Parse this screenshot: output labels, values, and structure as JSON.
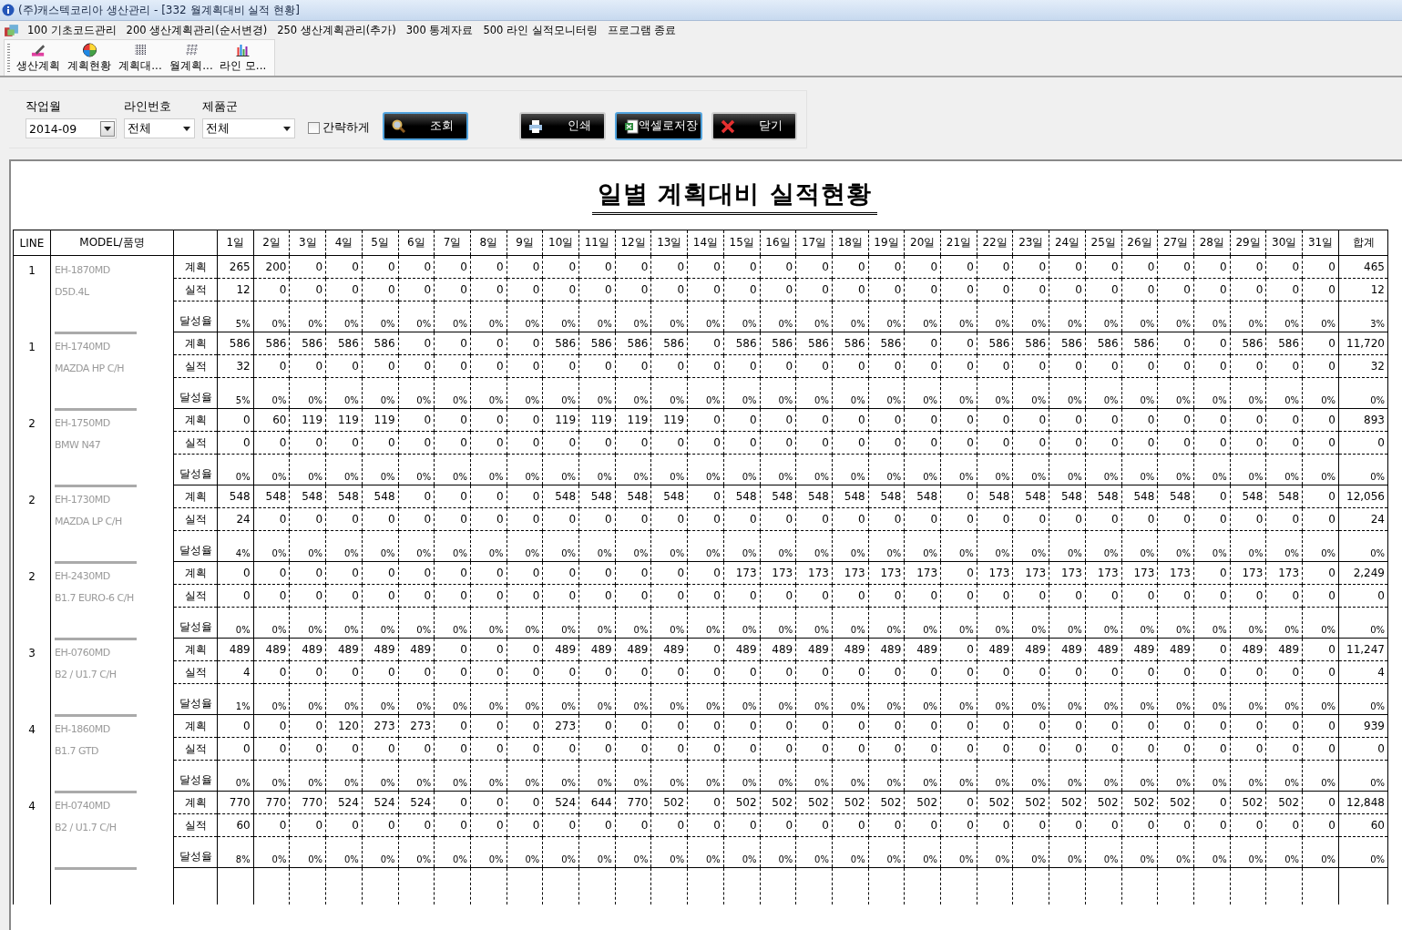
{
  "window": {
    "title": "(주)캐스텍코리아 생산관리 - [332 월계획대비 실적 현황]"
  },
  "menu": [
    {
      "label": "100 기초코드관리"
    },
    {
      "label": "200 생산계획관리(순서변경)"
    },
    {
      "label": "250 생산계획관리(추가)"
    },
    {
      "label": "300 통계자료"
    },
    {
      "label": "500 라인 실적모니터링"
    },
    {
      "label": "프로그램 종료"
    }
  ],
  "toolbar": [
    {
      "label": "생산계획",
      "kind": "pencil"
    },
    {
      "label": "계획현황",
      "kind": "wheel"
    },
    {
      "label": "계획대...",
      "kind": "grid"
    },
    {
      "label": "월계획...",
      "kind": "dots"
    },
    {
      "label": "라인 모...",
      "kind": "bars"
    }
  ],
  "filters": [
    {
      "label": "작업월",
      "value": "2014-09",
      "kind": "spin"
    },
    {
      "label": "라인번호",
      "value": "전체",
      "kind": "dropdown"
    },
    {
      "label": "제품군",
      "value": "전체",
      "kind": "dropdown"
    }
  ],
  "compact_option": {
    "label": "간략하게",
    "checked": false
  },
  "buttons": [
    {
      "label": "조회",
      "kind": "search",
      "highlighted": true
    },
    {
      "label": "인쇄",
      "kind": "print",
      "highlighted": false
    },
    {
      "label": "액셀로저장",
      "kind": "excel",
      "highlighted": true
    },
    {
      "label": "닫기",
      "kind": "close",
      "highlighted": false
    }
  ],
  "report": {
    "title": "일별 계획대비 실적현황",
    "columns": {
      "line": "LINE",
      "model": "MODEL/품명",
      "days": [
        "1일",
        "2일",
        "3일",
        "4일",
        "5일",
        "6일",
        "7일",
        "8일",
        "9일",
        "10일",
        "11일",
        "12일",
        "13일",
        "14일",
        "15일",
        "16일",
        "17일",
        "18일",
        "19일",
        "20일",
        "21일",
        "22일",
        "23일",
        "24일",
        "25일",
        "26일",
        "27일",
        "28일",
        "29일",
        "30일",
        "31일"
      ],
      "total": "합계"
    },
    "groups": [
      {
        "line": "1",
        "model": [
          "EH-1870MD",
          "D5D.4L"
        ],
        "rows": [
          {
            "kind": "plan",
            "label": "계획",
            "values": [
              "265",
              "200",
              "0",
              "0",
              "0",
              "0",
              "0",
              "0",
              "0",
              "0",
              "0",
              "0",
              "0",
              "0",
              "0",
              "0",
              "0",
              "0",
              "0",
              "0",
              "0",
              "0",
              "0",
              "0",
              "0",
              "0",
              "0",
              "0",
              "0",
              "0",
              "0"
            ],
            "total": "465"
          },
          {
            "kind": "actual",
            "label": "실적",
            "values": [
              "12",
              "0",
              "0",
              "0",
              "0",
              "0",
              "0",
              "0",
              "0",
              "0",
              "0",
              "0",
              "0",
              "0",
              "0",
              "0",
              "0",
              "0",
              "0",
              "0",
              "0",
              "0",
              "0",
              "0",
              "0",
              "0",
              "0",
              "0",
              "0",
              "0",
              "0"
            ],
            "total": "12"
          },
          {
            "kind": "rate",
            "label": "달성율",
            "values": [
              "5%",
              "0%",
              "0%",
              "0%",
              "0%",
              "0%",
              "0%",
              "0%",
              "0%",
              "0%",
              "0%",
              "0%",
              "0%",
              "0%",
              "0%",
              "0%",
              "0%",
              "0%",
              "0%",
              "0%",
              "0%",
              "0%",
              "0%",
              "0%",
              "0%",
              "0%",
              "0%",
              "0%",
              "0%",
              "0%",
              "0%"
            ],
            "total": "3%"
          }
        ]
      },
      {
        "line": "1",
        "model": [
          "EH-1740MD",
          "MAZDA HP C/H"
        ],
        "rows": [
          {
            "kind": "plan",
            "label": "계획",
            "values": [
              "586",
              "586",
              "586",
              "586",
              "586",
              "0",
              "0",
              "0",
              "0",
              "586",
              "586",
              "586",
              "586",
              "0",
              "586",
              "586",
              "586",
              "586",
              "586",
              "0",
              "0",
              "586",
              "586",
              "586",
              "586",
              "586",
              "0",
              "0",
              "586",
              "586",
              "0"
            ],
            "total": "11,720"
          },
          {
            "kind": "actual",
            "label": "실적",
            "values": [
              "32",
              "0",
              "0",
              "0",
              "0",
              "0",
              "0",
              "0",
              "0",
              "0",
              "0",
              "0",
              "0",
              "0",
              "0",
              "0",
              "0",
              "0",
              "0",
              "0",
              "0",
              "0",
              "0",
              "0",
              "0",
              "0",
              "0",
              "0",
              "0",
              "0",
              "0"
            ],
            "total": "32"
          },
          {
            "kind": "rate",
            "label": "달성율",
            "values": [
              "5%",
              "0%",
              "0%",
              "0%",
              "0%",
              "0%",
              "0%",
              "0%",
              "0%",
              "0%",
              "0%",
              "0%",
              "0%",
              "0%",
              "0%",
              "0%",
              "0%",
              "0%",
              "0%",
              "0%",
              "0%",
              "0%",
              "0%",
              "0%",
              "0%",
              "0%",
              "0%",
              "0%",
              "0%",
              "0%",
              "0%"
            ],
            "total": "0%"
          }
        ]
      },
      {
        "line": "2",
        "model": [
          "EH-1750MD",
          "BMW N47"
        ],
        "rows": [
          {
            "kind": "plan",
            "label": "계획",
            "values": [
              "0",
              "60",
              "119",
              "119",
              "119",
              "0",
              "0",
              "0",
              "0",
              "119",
              "119",
              "119",
              "119",
              "0",
              "0",
              "0",
              "0",
              "0",
              "0",
              "0",
              "0",
              "0",
              "0",
              "0",
              "0",
              "0",
              "0",
              "0",
              "0",
              "0",
              "0"
            ],
            "total": "893"
          },
          {
            "kind": "actual",
            "label": "실적",
            "values": [
              "0",
              "0",
              "0",
              "0",
              "0",
              "0",
              "0",
              "0",
              "0",
              "0",
              "0",
              "0",
              "0",
              "0",
              "0",
              "0",
              "0",
              "0",
              "0",
              "0",
              "0",
              "0",
              "0",
              "0",
              "0",
              "0",
              "0",
              "0",
              "0",
              "0",
              "0"
            ],
            "total": "0"
          },
          {
            "kind": "rate",
            "label": "달성율",
            "values": [
              "0%",
              "0%",
              "0%",
              "0%",
              "0%",
              "0%",
              "0%",
              "0%",
              "0%",
              "0%",
              "0%",
              "0%",
              "0%",
              "0%",
              "0%",
              "0%",
              "0%",
              "0%",
              "0%",
              "0%",
              "0%",
              "0%",
              "0%",
              "0%",
              "0%",
              "0%",
              "0%",
              "0%",
              "0%",
              "0%",
              "0%"
            ],
            "total": "0%"
          }
        ]
      },
      {
        "line": "2",
        "model": [
          "EH-1730MD",
          "MAZDA LP C/H"
        ],
        "rows": [
          {
            "kind": "plan",
            "label": "계획",
            "values": [
              "548",
              "548",
              "548",
              "548",
              "548",
              "0",
              "0",
              "0",
              "0",
              "548",
              "548",
              "548",
              "548",
              "0",
              "548",
              "548",
              "548",
              "548",
              "548",
              "548",
              "0",
              "548",
              "548",
              "548",
              "548",
              "548",
              "548",
              "0",
              "548",
              "548",
              "0"
            ],
            "total": "12,056"
          },
          {
            "kind": "actual",
            "label": "실적",
            "values": [
              "24",
              "0",
              "0",
              "0",
              "0",
              "0",
              "0",
              "0",
              "0",
              "0",
              "0",
              "0",
              "0",
              "0",
              "0",
              "0",
              "0",
              "0",
              "0",
              "0",
              "0",
              "0",
              "0",
              "0",
              "0",
              "0",
              "0",
              "0",
              "0",
              "0",
              "0"
            ],
            "total": "24"
          },
          {
            "kind": "rate",
            "label": "달성율",
            "values": [
              "4%",
              "0%",
              "0%",
              "0%",
              "0%",
              "0%",
              "0%",
              "0%",
              "0%",
              "0%",
              "0%",
              "0%",
              "0%",
              "0%",
              "0%",
              "0%",
              "0%",
              "0%",
              "0%",
              "0%",
              "0%",
              "0%",
              "0%",
              "0%",
              "0%",
              "0%",
              "0%",
              "0%",
              "0%",
              "0%",
              "0%"
            ],
            "total": "0%"
          }
        ]
      },
      {
        "line": "2",
        "model": [
          "EH-2430MD",
          "B1.7 EURO-6 C/H"
        ],
        "rows": [
          {
            "kind": "plan",
            "label": "계획",
            "values": [
              "0",
              "0",
              "0",
              "0",
              "0",
              "0",
              "0",
              "0",
              "0",
              "0",
              "0",
              "0",
              "0",
              "0",
              "173",
              "173",
              "173",
              "173",
              "173",
              "173",
              "0",
              "173",
              "173",
              "173",
              "173",
              "173",
              "173",
              "0",
              "173",
              "173",
              "0"
            ],
            "total": "2,249"
          },
          {
            "kind": "actual",
            "label": "실적",
            "values": [
              "0",
              "0",
              "0",
              "0",
              "0",
              "0",
              "0",
              "0",
              "0",
              "0",
              "0",
              "0",
              "0",
              "0",
              "0",
              "0",
              "0",
              "0",
              "0",
              "0",
              "0",
              "0",
              "0",
              "0",
              "0",
              "0",
              "0",
              "0",
              "0",
              "0",
              "0"
            ],
            "total": "0"
          },
          {
            "kind": "rate",
            "label": "달성율",
            "values": [
              "0%",
              "0%",
              "0%",
              "0%",
              "0%",
              "0%",
              "0%",
              "0%",
              "0%",
              "0%",
              "0%",
              "0%",
              "0%",
              "0%",
              "0%",
              "0%",
              "0%",
              "0%",
              "0%",
              "0%",
              "0%",
              "0%",
              "0%",
              "0%",
              "0%",
              "0%",
              "0%",
              "0%",
              "0%",
              "0%",
              "0%"
            ],
            "total": "0%"
          }
        ]
      },
      {
        "line": "3",
        "model": [
          "EH-0760MD",
          "B2 / U1.7 C/H"
        ],
        "rows": [
          {
            "kind": "plan",
            "label": "계획",
            "values": [
              "489",
              "489",
              "489",
              "489",
              "489",
              "489",
              "0",
              "0",
              "0",
              "489",
              "489",
              "489",
              "489",
              "0",
              "489",
              "489",
              "489",
              "489",
              "489",
              "489",
              "0",
              "489",
              "489",
              "489",
              "489",
              "489",
              "489",
              "0",
              "489",
              "489",
              "0"
            ],
            "total": "11,247"
          },
          {
            "kind": "actual",
            "label": "실적",
            "values": [
              "4",
              "0",
              "0",
              "0",
              "0",
              "0",
              "0",
              "0",
              "0",
              "0",
              "0",
              "0",
              "0",
              "0",
              "0",
              "0",
              "0",
              "0",
              "0",
              "0",
              "0",
              "0",
              "0",
              "0",
              "0",
              "0",
              "0",
              "0",
              "0",
              "0",
              "0"
            ],
            "total": "4"
          },
          {
            "kind": "rate",
            "label": "달성율",
            "values": [
              "1%",
              "0%",
              "0%",
              "0%",
              "0%",
              "0%",
              "0%",
              "0%",
              "0%",
              "0%",
              "0%",
              "0%",
              "0%",
              "0%",
              "0%",
              "0%",
              "0%",
              "0%",
              "0%",
              "0%",
              "0%",
              "0%",
              "0%",
              "0%",
              "0%",
              "0%",
              "0%",
              "0%",
              "0%",
              "0%",
              "0%"
            ],
            "total": "0%"
          }
        ]
      },
      {
        "line": "4",
        "model": [
          "EH-1860MD",
          "B1.7 GTD"
        ],
        "rows": [
          {
            "kind": "plan",
            "label": "계획",
            "values": [
              "0",
              "0",
              "0",
              "120",
              "273",
              "273",
              "0",
              "0",
              "0",
              "273",
              "0",
              "0",
              "0",
              "0",
              "0",
              "0",
              "0",
              "0",
              "0",
              "0",
              "0",
              "0",
              "0",
              "0",
              "0",
              "0",
              "0",
              "0",
              "0",
              "0",
              "0"
            ],
            "total": "939"
          },
          {
            "kind": "actual",
            "label": "실적",
            "values": [
              "0",
              "0",
              "0",
              "0",
              "0",
              "0",
              "0",
              "0",
              "0",
              "0",
              "0",
              "0",
              "0",
              "0",
              "0",
              "0",
              "0",
              "0",
              "0",
              "0",
              "0",
              "0",
              "0",
              "0",
              "0",
              "0",
              "0",
              "0",
              "0",
              "0",
              "0"
            ],
            "total": "0"
          },
          {
            "kind": "rate",
            "label": "달성율",
            "values": [
              "0%",
              "0%",
              "0%",
              "0%",
              "0%",
              "0%",
              "0%",
              "0%",
              "0%",
              "0%",
              "0%",
              "0%",
              "0%",
              "0%",
              "0%",
              "0%",
              "0%",
              "0%",
              "0%",
              "0%",
              "0%",
              "0%",
              "0%",
              "0%",
              "0%",
              "0%",
              "0%",
              "0%",
              "0%",
              "0%",
              "0%"
            ],
            "total": "0%"
          }
        ]
      },
      {
        "line": "4",
        "model": [
          "EH-0740MD",
          "B2 / U1.7 C/H"
        ],
        "rows": [
          {
            "kind": "plan",
            "label": "계획",
            "values": [
              "770",
              "770",
              "770",
              "524",
              "524",
              "524",
              "0",
              "0",
              "0",
              "524",
              "644",
              "770",
              "502",
              "0",
              "502",
              "502",
              "502",
              "502",
              "502",
              "502",
              "0",
              "502",
              "502",
              "502",
              "502",
              "502",
              "502",
              "0",
              "502",
              "502",
              "0"
            ],
            "total": "12,848"
          },
          {
            "kind": "actual",
            "label": "실적",
            "values": [
              "60",
              "0",
              "0",
              "0",
              "0",
              "0",
              "0",
              "0",
              "0",
              "0",
              "0",
              "0",
              "0",
              "0",
              "0",
              "0",
              "0",
              "0",
              "0",
              "0",
              "0",
              "0",
              "0",
              "0",
              "0",
              "0",
              "0",
              "0",
              "0",
              "0",
              "0"
            ],
            "total": "60"
          },
          {
            "kind": "rate",
            "label": "달성율",
            "values": [
              "8%",
              "0%",
              "0%",
              "0%",
              "0%",
              "0%",
              "0%",
              "0%",
              "0%",
              "0%",
              "0%",
              "0%",
              "0%",
              "0%",
              "0%",
              "0%",
              "0%",
              "0%",
              "0%",
              "0%",
              "0%",
              "0%",
              "0%",
              "0%",
              "0%",
              "0%",
              "0%",
              "0%",
              "0%",
              "0%",
              "0%"
            ],
            "total": "0%"
          }
        ]
      }
    ]
  }
}
